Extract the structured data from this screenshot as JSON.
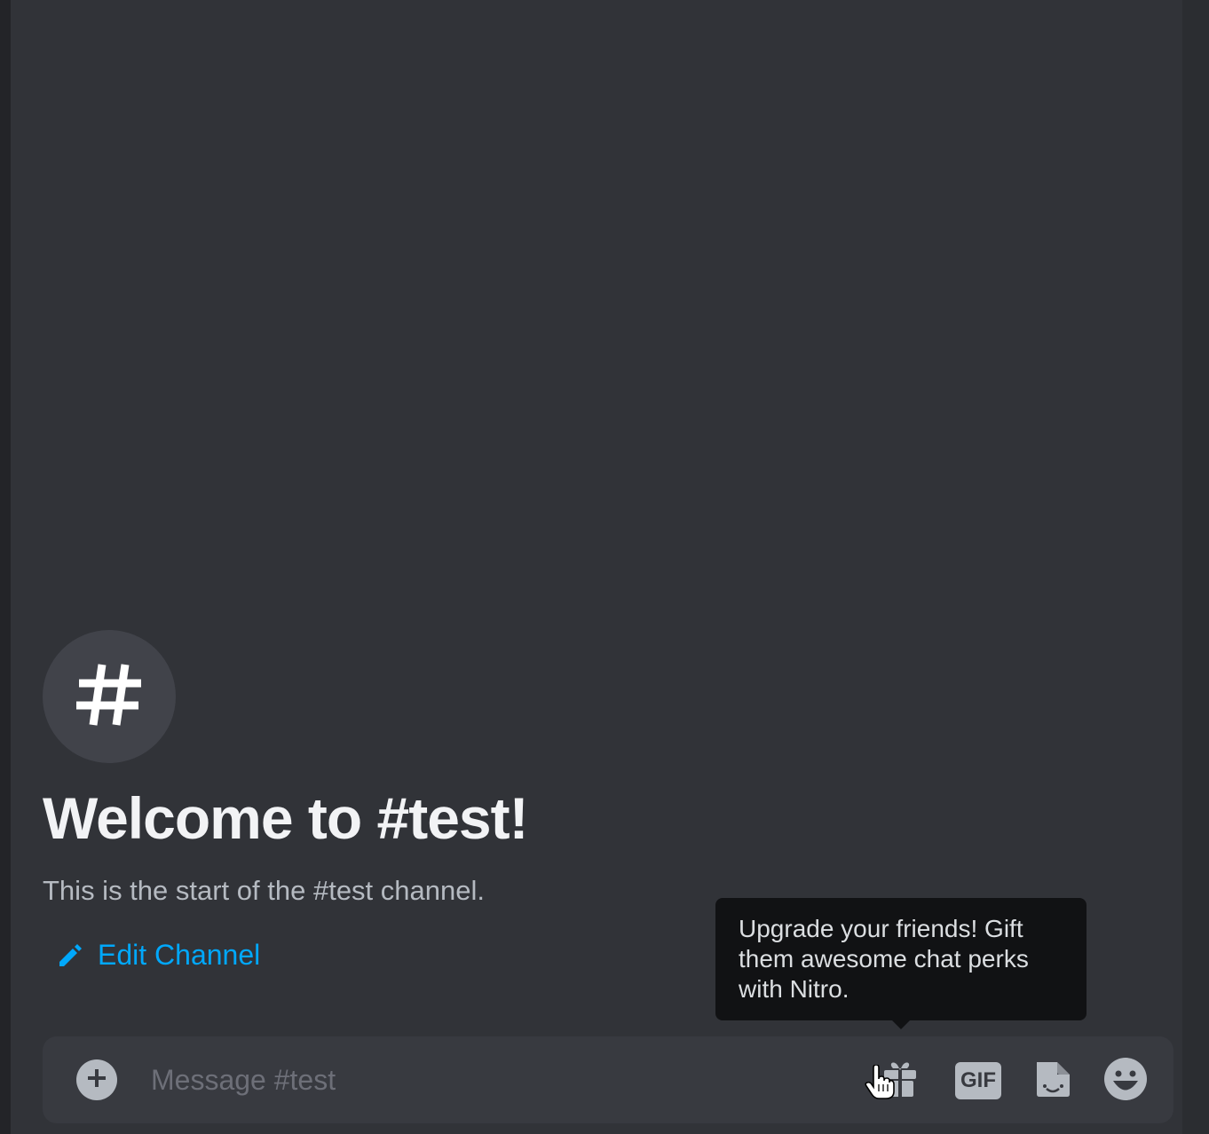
{
  "channel": {
    "avatar_icon": "hash-icon",
    "welcome_title": "Welcome to #test!",
    "welcome_subtitle": "This is the start of the #test channel.",
    "edit_label": "Edit Channel"
  },
  "tooltip": {
    "text": "Upgrade your friends! Gift them awesome chat perks with Nitro."
  },
  "composer": {
    "placeholder": "Message #test",
    "value": "",
    "attach_icon": "plus-circle-icon",
    "gift_icon": "gift-icon",
    "gif_label": "GIF",
    "sticker_icon": "sticker-icon",
    "emoji_icon": "emoji-icon"
  },
  "colors": {
    "background": "#313338",
    "composer": "#383a40",
    "accent_link": "#00a8fc",
    "tooltip_bg": "#111214",
    "icon": "#b5bac1"
  }
}
